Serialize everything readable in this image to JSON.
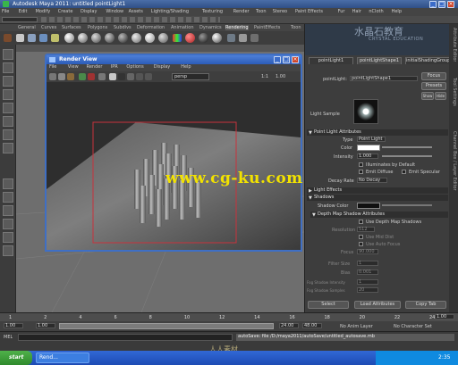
{
  "window": {
    "title": "Autodesk Maya 2011: untitled   pointLight1"
  },
  "menu": [
    "File",
    "Edit",
    "Modify",
    "Create",
    "Display",
    "Window",
    "Assets",
    "Lighting/Shading",
    "Texturing",
    "Render",
    "Toon",
    "Stereo",
    "Paint Effects",
    "Fur",
    "Hair",
    "nCloth",
    "Help"
  ],
  "shelf_tabs": [
    "General",
    "Curves",
    "Surfaces",
    "Polygons",
    "Subdivs",
    "Deformation",
    "Animation",
    "Dynamics",
    "Rendering",
    "PaintEffects",
    "Toon",
    "Muscle",
    "Fluids",
    "Fur",
    "Hair",
    "nCloth",
    "Custom"
  ],
  "render_view": {
    "title": "Render View",
    "menu": [
      "File",
      "View",
      "Render",
      "IPR",
      "Options",
      "Display",
      "Help"
    ],
    "camera_label": "persp",
    "ratio_label": "1:1",
    "zoom_label": "1.00"
  },
  "attribute_editor": {
    "top_tabs": [
      "pointLight1",
      "pointLightShape1",
      "initialShadingGroup"
    ],
    "node_field_label": "pointLight:",
    "node_name": "pointLightShape1",
    "focus_btn": "Focus",
    "presets_btn": "Presets",
    "show_btn": "Show",
    "hide_btn": "Hide",
    "sample_label": "Light Sample",
    "sections": {
      "point_attrs": "Point Light Attributes",
      "light_effects": "Light Effects",
      "shadows": "Shadows",
      "depth_map": "Depth Map Shadow Attributes"
    },
    "type_label": "Type",
    "type_value": "Point Light",
    "color_label": "Color",
    "intensity_label": "Intensity",
    "intensity_value": "1.000",
    "illum_default": "Illuminates by Default",
    "emit_diffuse": "Emit Diffuse",
    "emit_specular": "Emit Specular",
    "decay_label": "Decay Rate",
    "decay_value": "No Decay",
    "shadow_color_label": "Shadow Color",
    "use_depth_map": "Use Depth Map Shadows",
    "resolution_label": "Resolution",
    "resolution_value": "512",
    "use_mid_dist": "Use Mid Dist",
    "use_auto_focus": "Use Auto Focus",
    "focus_label": "Focus",
    "focus_value": "90.000",
    "filter_size_label": "Filter Size",
    "filter_size_value": "1",
    "bias_label": "Bias",
    "bias_value": "0.001",
    "fog_shadow_intensity_label": "Fog Shadow Intensity",
    "fog_shadow_intensity_value": "1",
    "fog_shadow_samples_label": "Fog Shadow Samples",
    "fog_shadow_samples_value": "20",
    "select_btn": "Select",
    "load_btn": "Load Attributes",
    "copy_btn": "Copy Tab"
  },
  "side_tabs": [
    "Attribute Editor",
    "Tool Settings",
    "Channel Box / Layer Editor"
  ],
  "timeline": {
    "ticks": [
      "1",
      "2",
      "4",
      "6",
      "8",
      "10",
      "12",
      "14",
      "16",
      "18",
      "20",
      "22",
      "24"
    ],
    "current": "1.00"
  },
  "range": {
    "start": "1.00",
    "end": "24.00",
    "anim_end": "48.00",
    "no_anim_layer": "No Anim Layer",
    "no_char_set": "No Character Set"
  },
  "command_line": {
    "prefix": "MEL",
    "text": "autoSave: file /D:/maya2011/autoSave/untitled_autosave.mb"
  },
  "taskbar": {
    "start": "start",
    "task": "Rend...",
    "clock": "2:35"
  },
  "watermarks": {
    "center": "www.cg-ku.com",
    "top_cn": "水晶石教育",
    "top_en": "CRYSTAL EDUCATION",
    "bottom": "人人素材"
  },
  "colors": {
    "titlebar": "#3a5f9e",
    "render_window_frame": "#2c5cb8",
    "render_region": "#c8323c",
    "watermark": "#f2e200",
    "taskbar": "#2458c8",
    "start_button": "#3f9c3a"
  }
}
